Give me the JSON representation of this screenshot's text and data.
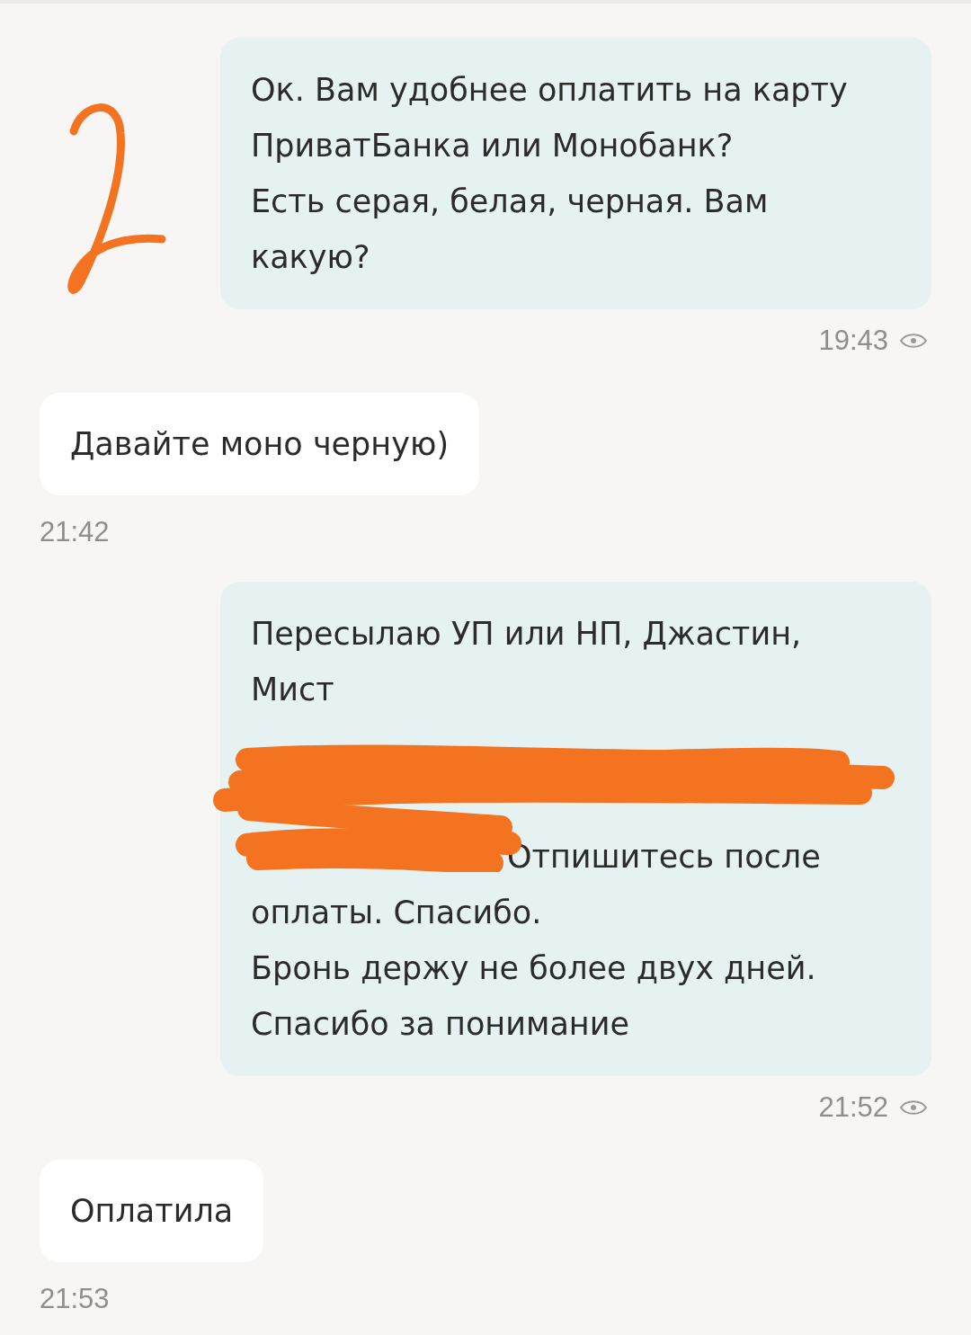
{
  "messages": [
    {
      "kind": "outgoing",
      "blocks": [
        {
          "kind": "text",
          "text": "Ок. Вам удобнее оплатить на карту ПриватБанка или Монобанк?"
        },
        {
          "kind": "text",
          "text": "Есть серая, белая, черная. Вам какую?"
        }
      ],
      "time": "19:43",
      "seen": true
    },
    {
      "kind": "incoming",
      "blocks": [
        {
          "kind": "text",
          "text": "Давайте моно черную)"
        }
      ],
      "time": "21:42"
    },
    {
      "kind": "outgoing",
      "blocks": [
        {
          "kind": "text",
          "text": "Пересылаю УП или НП, Джастин, Мист"
        },
        {
          "kind": "gap"
        },
        {
          "kind": "redacted",
          "text": "Отпишитесь после оплаты. Спасибо."
        },
        {
          "kind": "text",
          "text": "Бронь держу не более двух дней."
        },
        {
          "kind": "text",
          "text": "Спасибо за понимание"
        }
      ],
      "time": "21:52",
      "seen": true
    },
    {
      "kind": "incoming",
      "blocks": [
        {
          "kind": "text",
          "text": "Оплатила"
        }
      ],
      "time": "21:53"
    }
  ]
}
